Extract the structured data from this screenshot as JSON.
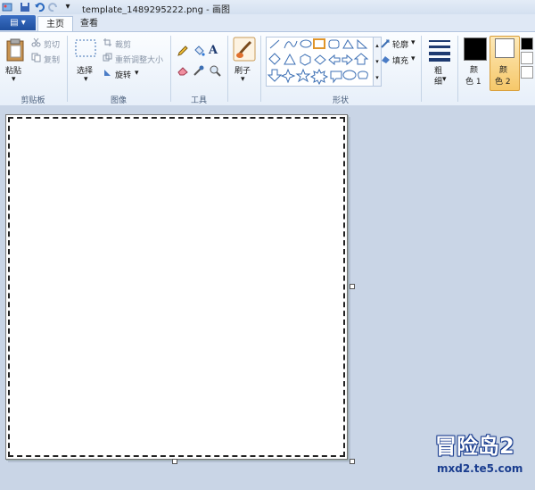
{
  "window": {
    "title": "template_1489295222.png - 画图",
    "qat": {
      "dropdown": "▾"
    }
  },
  "tabs": {
    "file_label": "▤ ▾",
    "home": "主页",
    "view": "查看"
  },
  "ribbon": {
    "clipboard": {
      "paste": "粘贴",
      "cut": "剪切",
      "copy": "复制",
      "group": "剪贴板"
    },
    "image": {
      "select": "选择",
      "crop": "裁剪",
      "resize": "重新调整大小",
      "rotate": "旋转",
      "group": "图像"
    },
    "tools": {
      "group": "工具"
    },
    "brushes": {
      "label": "刷子"
    },
    "shapes": {
      "outline": "轮廓",
      "fill": "填充",
      "group": "形状"
    },
    "size": {
      "label_1": "粗",
      "label_2": "细"
    },
    "color1": {
      "line1": "颜",
      "line2": "色 1",
      "value": "#000000"
    },
    "color2": {
      "line1": "颜",
      "line2": "色 2",
      "value": "#ffffff"
    }
  },
  "watermark": {
    "logo_text": "冒险岛2",
    "url": "mxd2.te5.com"
  },
  "colors": {
    "accent": "#f6c86a",
    "file_tab": "#2a5bb0",
    "workspace": "#c9d5e6"
  }
}
